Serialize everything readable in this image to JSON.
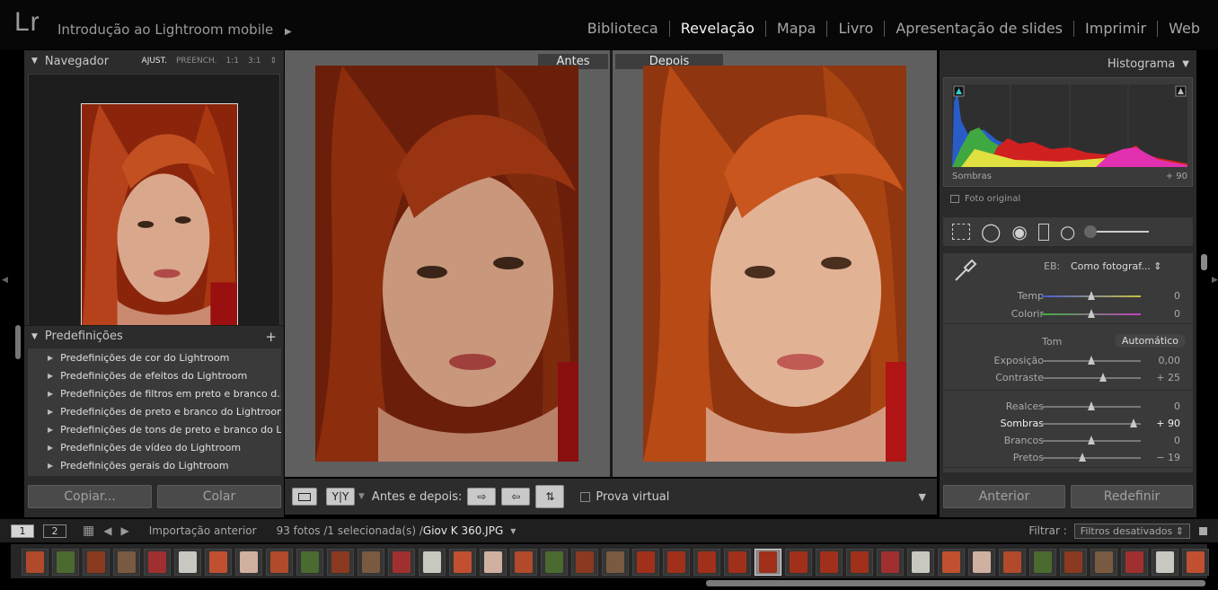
{
  "app": {
    "logo": "Lr",
    "catalog": "Introdução ao Lightroom mobile",
    "catalog_arrow": "▶"
  },
  "modules": [
    {
      "label": "Biblioteca",
      "active": false
    },
    {
      "label": "Revelação",
      "active": true
    },
    {
      "label": "Mapa",
      "active": false
    },
    {
      "label": "Livro",
      "active": false
    },
    {
      "label": "Apresentação de slides",
      "active": false
    },
    {
      "label": "Imprimir",
      "active": false
    },
    {
      "label": "Web",
      "active": false
    }
  ],
  "navigator": {
    "title": "Navegador",
    "zoom": [
      "AJUST.",
      "PREENCH.",
      "1:1",
      "3:1"
    ],
    "zoom_active": "AJUST.",
    "zoom_arrow": "⇕"
  },
  "presets": {
    "title": "Predefinições",
    "add": "+",
    "items": [
      "Predefinições de cor do Lightroom",
      "Predefinições de efeitos do Lightroom",
      "Predefinições de filtros em preto e branco d...",
      "Predefinições de preto e branco do Lightroom",
      "Predefinições de tons de preto e branco do L...",
      "Predefinições de vídeo do Lightroom",
      "Predefinições gerais do Lightroom"
    ]
  },
  "left_buttons": {
    "copy": "Copiar...",
    "paste": "Colar"
  },
  "view": {
    "before": "Antes",
    "after": "Depois"
  },
  "center_toolbar": {
    "yy": "Y|Y",
    "before_after": "Antes e depois:",
    "soft_proof": "Prova virtual"
  },
  "histogram": {
    "title": "Histograma",
    "label": "Sombras",
    "value": "+ 90",
    "original": "Foto original"
  },
  "wb": {
    "label": "EB:",
    "value": "Como fotograf... ⇕"
  },
  "tone": {
    "label": "Tom",
    "auto": "Automático"
  },
  "sliders": [
    {
      "key": "temp",
      "label": "Temp",
      "value": "0",
      "pos": 0.5,
      "track": "temp"
    },
    {
      "key": "tint",
      "label": "Colorir",
      "value": "0",
      "pos": 0.5,
      "track": "tint"
    },
    {
      "key": "exposure",
      "label": "Exposição",
      "value": "0,00",
      "pos": 0.5
    },
    {
      "key": "contrast",
      "label": "Contraste",
      "value": "+ 25",
      "pos": 0.62
    },
    {
      "key": "highlights",
      "label": "Realces",
      "value": "0",
      "pos": 0.5
    },
    {
      "key": "shadows",
      "label": "Sombras",
      "value": "+ 90",
      "pos": 0.93,
      "highlight": true
    },
    {
      "key": "whites",
      "label": "Brancos",
      "value": "0",
      "pos": 0.5
    },
    {
      "key": "blacks",
      "label": "Pretos",
      "value": "− 19",
      "pos": 0.41
    }
  ],
  "right_buttons": {
    "previous": "Anterior",
    "reset": "Redefinir"
  },
  "filmstrip_bar": {
    "view1": "1",
    "view2": "2",
    "source": "Importação anterior",
    "count": "93 fotos /1 selecionada(s) /",
    "filename": "Giov K 360.JPG",
    "filter_label": "Filtrar :",
    "filter_value": "Filtros desativados ⇕"
  },
  "colors": {
    "accent": "#f2f2f2",
    "panel": "#2a2a2a",
    "hair": "#b5421a"
  }
}
